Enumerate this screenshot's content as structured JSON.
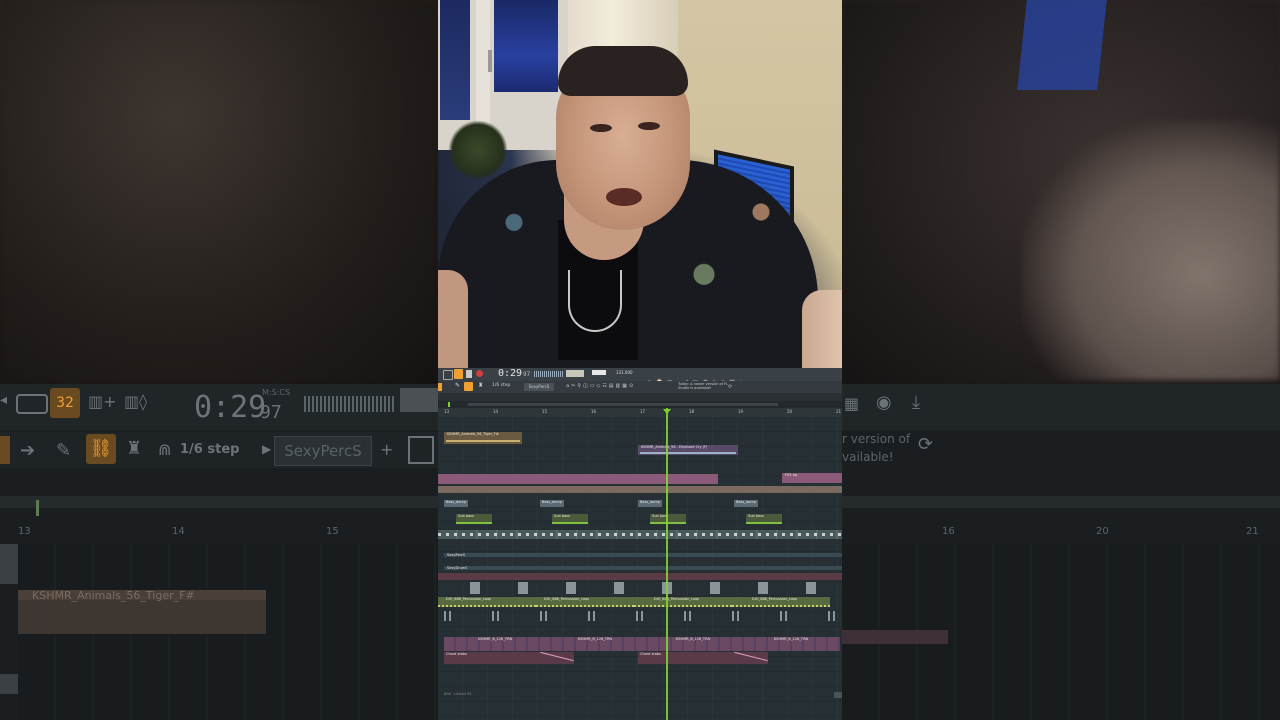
{
  "left_blur": {
    "time": "0:29",
    "time_ms": "97",
    "time_unit": "M:S:CS",
    "snap_label": "1/6 step",
    "pattern_name": "SexyPercS",
    "bar_13": "13",
    "bar_14": "14",
    "bar_15": "15",
    "clip_name": "KSHMR_Animals_56_Tiger_F#"
  },
  "right_blur": {
    "hint": "r version of",
    "hint2": "vailable!",
    "bar_16": "16",
    "bar_20": "20",
    "bar_21": "21"
  },
  "fl": {
    "time": "0:29",
    "time_ms": "97",
    "tempo": "131.000",
    "snap": "1/6 step",
    "pattern": "SexyPercS",
    "news": "Today: A newer version of FL Studio is available!",
    "bars": [
      "13",
      "",
      "14",
      "",
      "15",
      "",
      "16",
      "",
      "17",
      "",
      "18",
      "",
      "19",
      "",
      "20",
      "",
      "21"
    ],
    "clips": {
      "tiger": "KSHMR_Animals_56_Tiger_F#",
      "elephant": "KSHMR_Animals_56 - Elephant Cry (F)",
      "fx": "FX2 hp",
      "bass1": "Bass_dump",
      "bass2": "Bass_dump",
      "bass3": "Bass_dump",
      "bass4": "Bass_dump",
      "sub1": "Sub bass",
      "sub2": "Sub bass",
      "sub3": "Sub bass",
      "sub4": "Sub bass",
      "perc1": "SexyPercS",
      "perc2": "SexyDrumS",
      "loop1": "DIO_888_Percussion_Loop",
      "loop2": "DIO_888_Percussion_Loop",
      "loop3": "DIO_888_Percussion_Loop",
      "loop4": "DIO_888_Percussion_Loop",
      "k1": "KSHMR_B_126_TRN",
      "k2": "KSHMR_B_126_TRN",
      "k3": "KSHMR_B_126_TRN",
      "k4": "KSHMR_B_126_TRN",
      "rev1": "Chord stabs",
      "rev2": "Chord stabs",
      "bottom": "806 - Unison Rt"
    }
  },
  "colors": {
    "accent": "#f0a030",
    "playhead": "#7fd42a",
    "pink_track": "#8a5a78",
    "green_track": "#5d7a52"
  }
}
